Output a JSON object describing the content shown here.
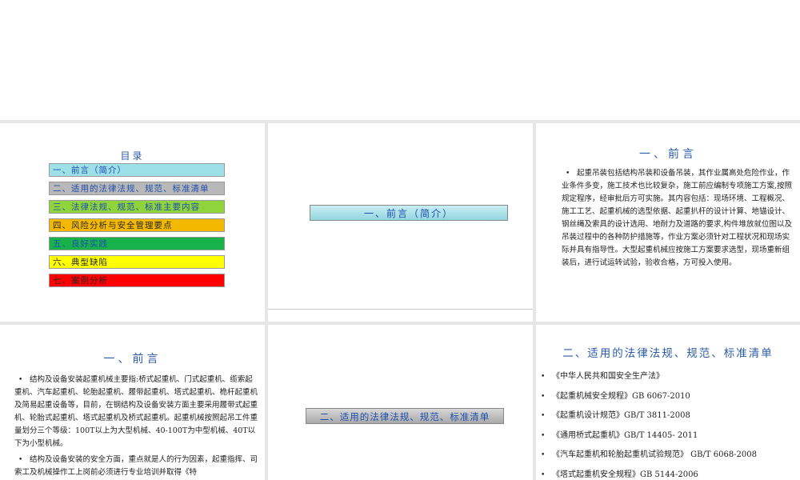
{
  "toc": {
    "title": "目录",
    "items": [
      {
        "label": "一、前言（简介）"
      },
      {
        "label": "二、适用的法律法规、规范、标准清单"
      },
      {
        "label": "三、法律法规、规范、标准主要内容"
      },
      {
        "label": "四、风险分析与安全管理要点"
      },
      {
        "label": "五、良好实践"
      },
      {
        "label": "六、典型缺陷"
      },
      {
        "label": "七、案例分析"
      }
    ]
  },
  "slide2": {
    "banner": "一、前言（简介）"
  },
  "slide3": {
    "heading": "一、前言",
    "bullets": [
      "起重吊装包括结构吊装和设备吊装，其作业属高处危险作业，作业条件多变，施工技术也比较复杂，施工前应编制专项施工方案,按照规定程序，经审批后方可实施。其内容包括：现场环境、工程概况、施工工艺、起重机械的选型依据、起重扒杆的设计计算、地锚设计、钢丝绳及索具的设计选用、地耐力及道路的要求,构件堆放就位图以及吊装过程中的各种防护措施等，作业方案必须针对工程状况和现场实际并具有指导性。大型起重机械应按施工方案要求选型，现场重新组装后，进行试运转试验，验收合格，方可投入使用。"
    ]
  },
  "slide4": {
    "heading": "一、前言",
    "bullets": [
      "结构及设备安装起重机械主要指:桥式起重机、门式起重机、缆索起重机、汽车起重机、轮胎起重机、履带起重机、塔式起重机、桅杆起重机及简易起重设备等，目前，在钢结构及设备安装方面主要采用履带式起重机、轮胎式起重机、塔式起重机及桥式起重机。起重机械按照起吊工件重量划分三个等级：100T以上为大型机械、40-100T为中型机械、40T以下为小型机械。",
      "结构及设备安装的安全方面，重点就是人的行为因素，起重指挥、司索工及机械操作工上岗前必须进行专业培训并取得《特"
    ]
  },
  "slide5": {
    "banner": "二、适用的法律法规、规范、标准清单"
  },
  "slide6": {
    "heading": "二、适用的法律法规、规范、标准清单",
    "bullets": [
      "《中华人民共和国安全生产法》",
      "《起重机械安全规程》GB  6067-2010",
      "《起重机设计规范》GB/T  3811-2008",
      "《通用桥式起重机》GB/T  14405- 2011",
      "《汽车起重机和轮胎起重机试验规范》 GB/T 6068-2008",
      "《塔式起重机安全规程》GB  5144-2006"
    ]
  },
  "colors": {
    "heading": "#2b5aa8",
    "toc_cyan": "#9ee0e8",
    "toc_gray": "#b8b8b8",
    "toc_lightgreen": "#8fd43a",
    "toc_orange": "#f5b800",
    "toc_green": "#17b34a",
    "toc_yellow": "#ffff00",
    "toc_red": "#ff0000"
  }
}
